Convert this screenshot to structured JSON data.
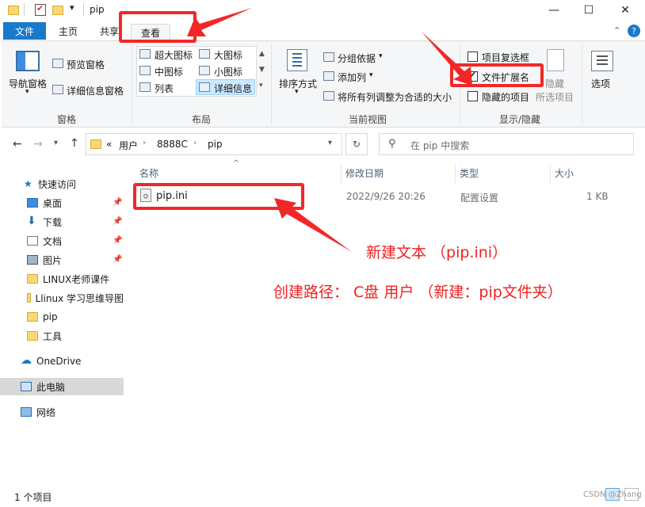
{
  "window": {
    "title": "pip",
    "controls": {
      "minimize": "—",
      "maximize": "☐",
      "close": "✕"
    }
  },
  "ribbon": {
    "tabs": {
      "file": "文件",
      "home": "主页",
      "share": "共享",
      "view": "查看"
    },
    "panes": {
      "label": "窗格",
      "nav_pane": "导航窗格",
      "preview_pane": "预览窗格",
      "details_pane": "详细信息窗格"
    },
    "layout": {
      "label": "布局",
      "items": [
        "超大图标",
        "大图标",
        "中图标",
        "小图标",
        "列表",
        "详细信息"
      ]
    },
    "current_view": {
      "label": "当前视图",
      "sort_by": "排序方式",
      "group_by": "分组依据",
      "add_columns": "添加列",
      "size_all_columns": "将所有列调整为合适的大小"
    },
    "show_hide": {
      "label": "显示/隐藏",
      "item_checkboxes": "项目复选框",
      "file_extensions": "文件扩展名",
      "hidden_items": "隐藏的项目",
      "hide": "隐藏",
      "hide_selected": "所选项目",
      "options": "选项",
      "file_extensions_checked": true
    }
  },
  "address": {
    "segments": [
      "«",
      "用户",
      "8888C",
      "pip"
    ],
    "search_placeholder": "在 pip 中搜索"
  },
  "nav": {
    "quick_access": "快速访问",
    "items": [
      "桌面",
      "下载",
      "文档",
      "图片",
      "LINUX老师课件",
      "Llinux 学习思维导图",
      "pip",
      "工具"
    ],
    "onedrive": "OneDrive",
    "this_pc": "此电脑",
    "network": "网络"
  },
  "file_list": {
    "columns": [
      "名称",
      "修改日期",
      "类型",
      "大小"
    ],
    "rows": [
      {
        "name": "pip.ini",
        "modified": "2022/9/26 20:26",
        "type": "配置设置",
        "size": "1 KB"
      }
    ]
  },
  "annotations": {
    "line1": "新建文本 （pip.ini）",
    "line2": "创建路径： C盘  用户 （新建：pip文件夹）"
  },
  "status": {
    "count": "1 个项目"
  },
  "watermark": "CSDN @Zhang",
  "colors": {
    "accent": "#1979ca",
    "annotation_red": "#f02020"
  }
}
